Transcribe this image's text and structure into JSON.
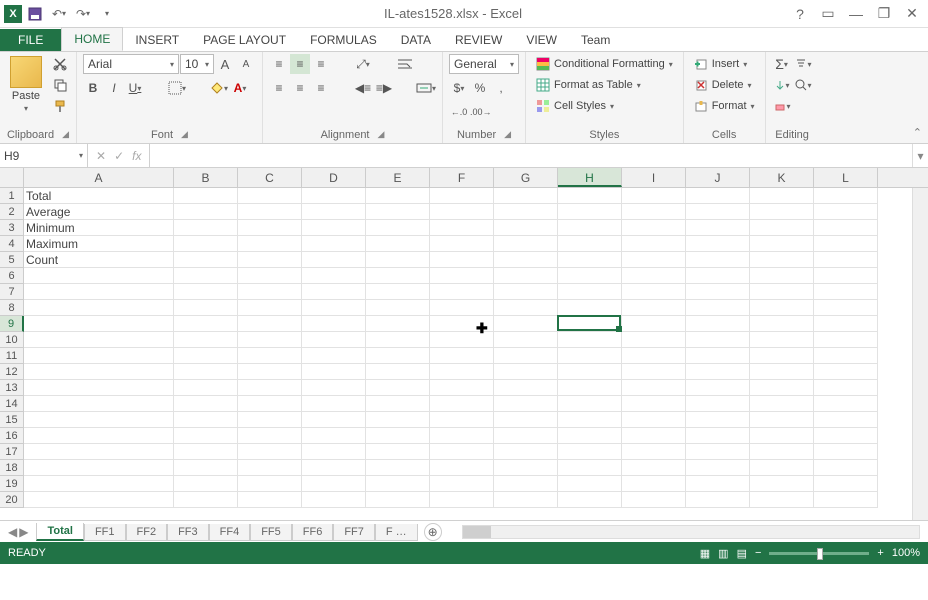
{
  "app": {
    "title": "IL-ates1528.xlsx - Excel",
    "icon_letter": "X"
  },
  "window_buttons": {
    "help": "?",
    "ribbon_opts": "▭",
    "min": "—",
    "restore": "❐",
    "close": "✕"
  },
  "tabs": {
    "file": "FILE",
    "items": [
      "HOME",
      "INSERT",
      "PAGE LAYOUT",
      "FORMULAS",
      "DATA",
      "REVIEW",
      "VIEW",
      "Team"
    ],
    "active": "HOME"
  },
  "ribbon": {
    "clipboard": {
      "label": "Clipboard",
      "paste": "Paste"
    },
    "font": {
      "label": "Font",
      "name": "Arial",
      "size": "10",
      "increase": "A",
      "decrease": "A",
      "bold": "B",
      "italic": "I",
      "underline": "U"
    },
    "alignment": {
      "label": "Alignment"
    },
    "number": {
      "label": "Number",
      "format": "General",
      "currency": "$",
      "percent": "%",
      "comma": ",",
      "inc_dec": "←.0",
      "dec_dec": ".00→"
    },
    "styles": {
      "label": "Styles",
      "cond": "Conditional Formatting",
      "table": "Format as Table",
      "cell": "Cell Styles"
    },
    "cells": {
      "label": "Cells",
      "insert": "Insert",
      "delete": "Delete",
      "format": "Format"
    },
    "editing": {
      "label": "Editing",
      "sum": "Σ",
      "fill": "▾",
      "clear": "◇"
    }
  },
  "formula_bar": {
    "name_box": "H9",
    "fx": "fx",
    "value": ""
  },
  "grid": {
    "columns": [
      "A",
      "B",
      "C",
      "D",
      "E",
      "F",
      "G",
      "H",
      "I",
      "J",
      "K",
      "L"
    ],
    "active_col": "H",
    "rows": 20,
    "active_row": 9,
    "data": {
      "A1": "Total",
      "A2": "Average",
      "A3": "Minimum",
      "A4": "Maximum",
      "A5": "Count"
    },
    "selected_cell": "H9"
  },
  "sheets": {
    "active": "Total",
    "tabs": [
      "Total",
      "FF1",
      "FF2",
      "FF3",
      "FF4",
      "FF5",
      "FF6",
      "FF7",
      "F …"
    ]
  },
  "status": {
    "state": "READY",
    "zoom": "100%"
  }
}
